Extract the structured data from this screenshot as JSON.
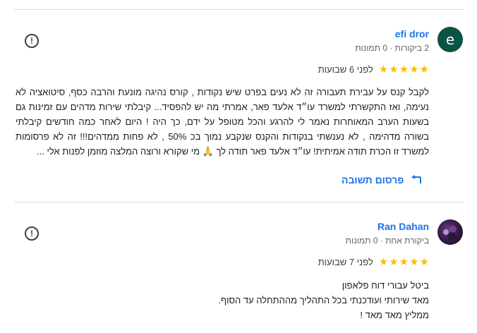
{
  "reviews": [
    {
      "avatar_letter": "e",
      "author": "efi dror",
      "meta": "2 ביקורות · 0 תמונות",
      "rating": 5,
      "date": "לפני 6 שבועות",
      "text": "לקבל קנס על עבירת תעבורה זה לא נעים בפרט שיש נקודות , קורס נהיגה מונעת והרבה כסף, סיטואציה לא נעימה, ואז התקשרתי למשרד עו״ד אלעד פאר, אמרתי מה יש להפסיד... קיבלתי שירות מדהים עם זמינות גם בשעות הערב המאוחרות נאמר לי להרגע והכל מטופל על ידם, כך היה ! היום לאחר כמה חודשים קיבלתי בשורה מדהימה , לא נענשתי בנקודות והקנס שנקבע נמוך בכ 50% , לא פחות ממדהים!!! זה לא פרסומות למשרד זו הכרת תודה אמיתית! עו״ד אלעד פאר תודה לך 🙏 מי שקורא ורוצה המלצה מוזמן לפנות אלי ...",
      "reply_label": "פרסום תשובה"
    },
    {
      "author": "Ran Dahan",
      "meta": "ביקורת אחת · 0 תמונות",
      "rating": 5,
      "date": "לפני 7 שבועות",
      "lines": [
        "ביטל עבורי דוח פלאפון",
        "מאד שירותי ועודכנתי בכל התהליך מההתחלה עד הסוף.",
        "ממליץ מאד מאד !"
      ]
    }
  ],
  "icons": {
    "flag": "flag-icon",
    "reply": "reply-arrow-icon",
    "star": "star-icon"
  },
  "colors": {
    "link": "#1a73e8",
    "star": "#fbbc04",
    "avatar_e": "#0b5345"
  }
}
